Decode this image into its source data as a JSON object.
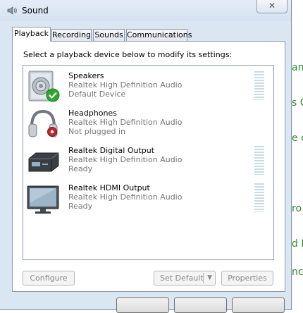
{
  "window": {
    "title": "Sound",
    "close_label": "✕"
  },
  "tabs": [
    {
      "label": "Playback",
      "active": true
    },
    {
      "label": "Recording",
      "active": false
    },
    {
      "label": "Sounds",
      "active": false
    },
    {
      "label": "Communications",
      "active": false
    }
  ],
  "instruction": "Select a playback device below to modify its settings:",
  "devices": [
    {
      "name": "Speakers",
      "driver": "Realtek High Definition Audio",
      "status": "Default Device",
      "icon": "speaker-icon",
      "badge": "default-check-icon"
    },
    {
      "name": "Headphones",
      "driver": "Realtek High Definition Audio",
      "status": "Not plugged in",
      "icon": "headphones-icon",
      "badge": "unplugged-icon"
    },
    {
      "name": "Realtek Digital Output",
      "driver": "Realtek High Definition Audio",
      "status": "Ready",
      "icon": "digital-output-icon"
    },
    {
      "name": "Realtek HDMI Output",
      "driver": "Realtek High Definition Audio",
      "status": "Ready",
      "icon": "hdmi-monitor-icon"
    }
  ],
  "buttons": {
    "configure": "Configure",
    "set_default": "Set Default",
    "set_default_arrow": "▼",
    "properties": "Properties"
  },
  "background_text": [
    "an",
    "s C",
    "e c",
    "ro",
    "d F",
    "nc"
  ],
  "colors": {
    "window_frame": "#dbe6f3",
    "background_link": "#2e8b2e",
    "disabled_text": "#8a8a8a",
    "secondary_text": "#757575",
    "check_badge": "#2ea82e",
    "unplugged_badge": "#c0282d"
  }
}
